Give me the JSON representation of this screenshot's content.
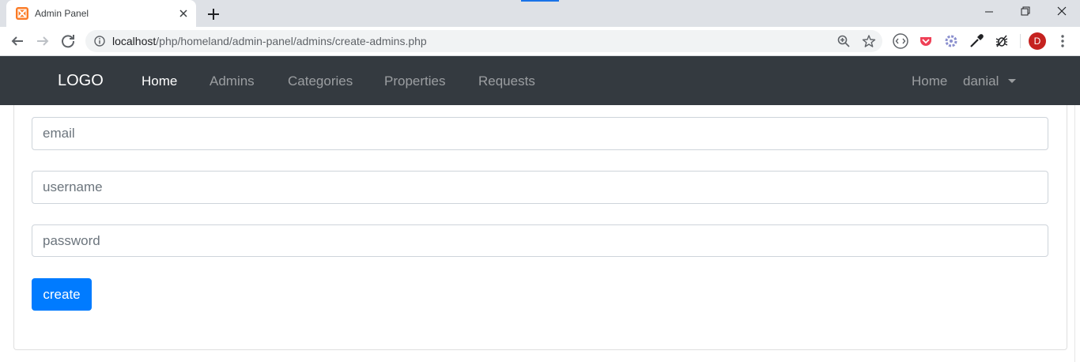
{
  "browser": {
    "tab_title": "Admin Panel",
    "url_host": "localhost",
    "url_path": "/php/homeland/admin-panel/admins/create-admins.php",
    "profile_initial": "D",
    "icons": [
      "favicon-icon",
      "close-icon",
      "plus-icon",
      "minimize-icon",
      "maximize-icon",
      "close-window-icon",
      "back-icon",
      "forward-icon",
      "reload-icon",
      "info-icon",
      "zoom-icon",
      "star-icon",
      "kebab-menu-icon"
    ]
  },
  "navbar": {
    "brand": "LOGO",
    "links": [
      "Home",
      "Admins",
      "Categories",
      "Properties",
      "Requests"
    ],
    "right_home": "Home",
    "user": "danial",
    "bg_color": "#343a40"
  },
  "form": {
    "email_placeholder": "email",
    "username_placeholder": "username",
    "password_placeholder": "password",
    "submit_label": "create",
    "accent_color": "#007bff"
  }
}
